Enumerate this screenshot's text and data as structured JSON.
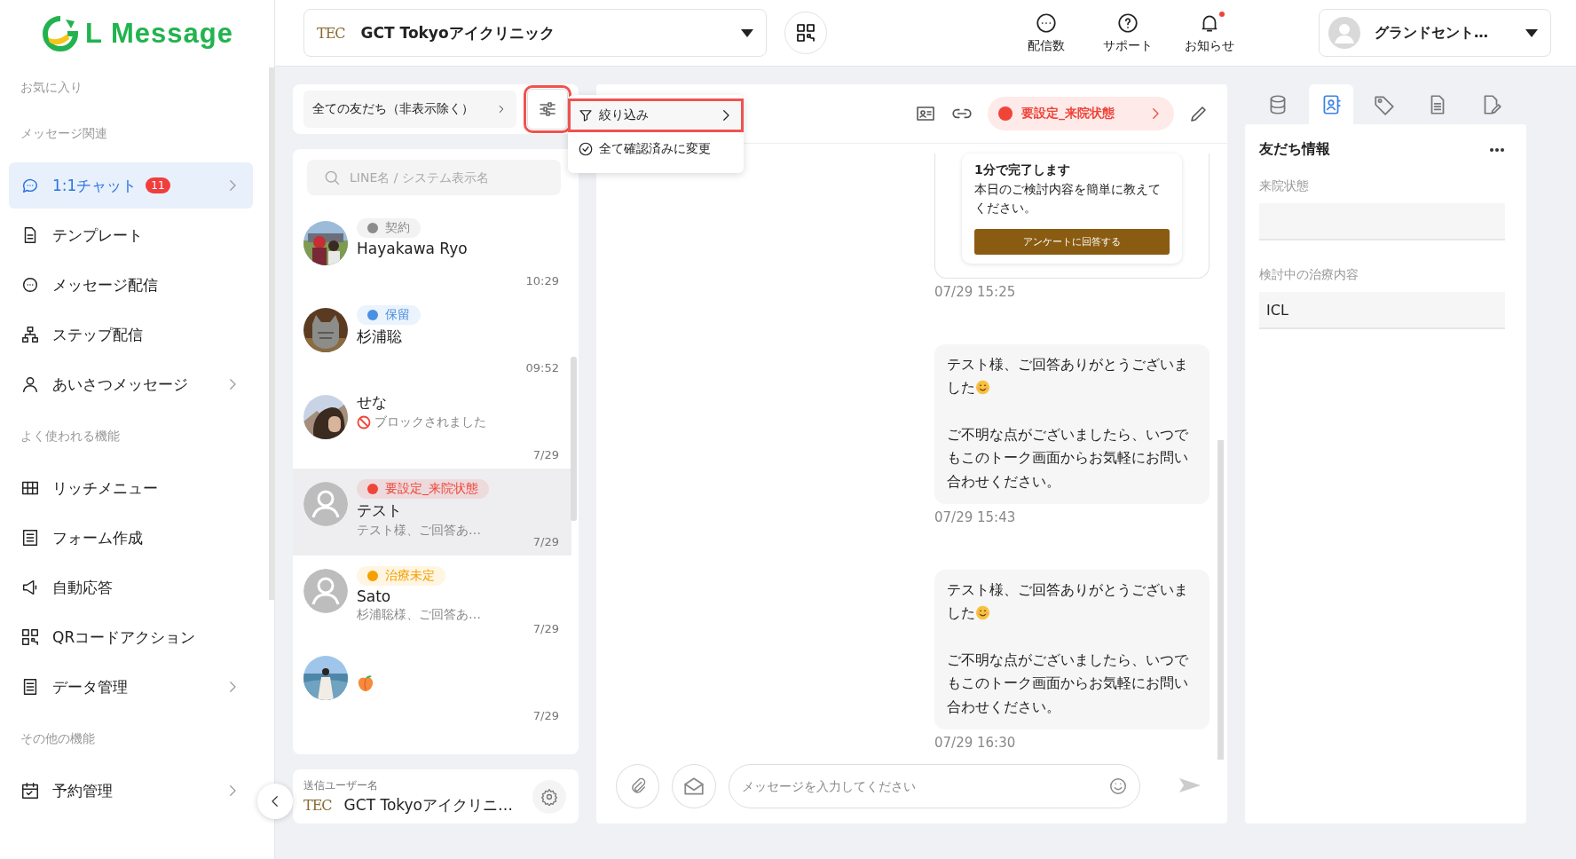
{
  "sidebar": {
    "logo": "L Message",
    "items": [
      {
        "kind": "heading",
        "label": "お気に入り"
      },
      {
        "kind": "heading",
        "label": "メッセージ関連"
      },
      {
        "kind": "item",
        "label": "1:1チャット",
        "selected": true,
        "badge": "11",
        "has_submenu": true
      },
      {
        "kind": "item",
        "label": "テンプレート",
        "selected": false,
        "has_submenu": false
      },
      {
        "kind": "item",
        "label": "メッセージ配信",
        "selected": false,
        "has_submenu": false
      },
      {
        "kind": "item",
        "label": "ステップ配信",
        "selected": false,
        "has_submenu": false
      },
      {
        "kind": "item",
        "label": "あいさつメッセージ",
        "selected": false,
        "has_submenu": true
      },
      {
        "kind": "heading",
        "label": "よく使われる機能"
      },
      {
        "kind": "item",
        "label": "リッチメニュー",
        "selected": false,
        "has_submenu": false
      },
      {
        "kind": "item",
        "label": "フォーム作成",
        "selected": false,
        "has_submenu": false
      },
      {
        "kind": "item",
        "label": "自動応答",
        "selected": false,
        "has_submenu": false
      },
      {
        "kind": "item",
        "label": "QRコードアクション",
        "selected": false,
        "has_submenu": false
      },
      {
        "kind": "item",
        "label": "データ管理",
        "selected": false,
        "has_submenu": true
      },
      {
        "kind": "heading",
        "label": "その他の機能"
      },
      {
        "kind": "item",
        "label": "予約管理",
        "selected": false,
        "has_submenu": true
      }
    ]
  },
  "topbar": {
    "account": {
      "logo": "TEC",
      "name": "GCT Tokyoアイクリニック"
    },
    "actions": [
      {
        "label": "配信数",
        "unread": false
      },
      {
        "label": "サポート",
        "unread": false
      },
      {
        "label": "お知らせ",
        "unread": true
      }
    ],
    "user": {
      "name": "グランドセント…"
    }
  },
  "chat_list": {
    "filter_label": "全ての友だち（非表示除く）",
    "filter_button_highlighted": true,
    "menu": [
      {
        "label": "絞り込み",
        "highlighted": true,
        "has_submenu": true
      },
      {
        "label": "全て確認済みに変更",
        "highlighted": false,
        "has_submenu": false
      }
    ],
    "search_placeholder": "LINE名 / システム表示名",
    "chats": [
      {
        "kind": "text",
        "has_photo": true,
        "tag": {
          "label": "契約",
          "color": "#8c8c8c"
        },
        "name": "Hayakawa Ryo",
        "time": "10:29",
        "selected": false,
        "blocked": false
      },
      {
        "kind": "text",
        "has_photo": true,
        "tag": {
          "label": "保留",
          "color": "#4a90e2"
        },
        "name": "杉浦聡",
        "time": "09:52",
        "selected": false,
        "blocked": false
      },
      {
        "kind": "text",
        "has_photo": true,
        "name": "せな",
        "preview": "ブロックされました",
        "time": "7/29",
        "selected": false,
        "blocked": true
      },
      {
        "kind": "text",
        "has_photo": false,
        "tag": {
          "label": "要設定_来院状態",
          "color": "#f04438"
        },
        "name": "テスト",
        "preview": "テスト様、ご回答あ…",
        "time": "7/29",
        "selected": true,
        "blocked": false
      },
      {
        "kind": "text",
        "has_photo": false,
        "tag": {
          "label": "治療未定",
          "color": "#f5a000"
        },
        "name": "Sato",
        "preview": "杉浦聡様、ご回答あ…",
        "time": "7/29",
        "selected": false,
        "blocked": false
      },
      {
        "kind": "emoji",
        "has_photo": true,
        "time": "7/29",
        "selected": false,
        "blocked": false
      }
    ],
    "sender": {
      "label": "送信ユーザー名",
      "logo": "TEC",
      "name": "GCT Tokyoアイクリニ…"
    }
  },
  "chat": {
    "status_tag": {
      "label": "要設定_来院状態",
      "color": "#f04438"
    },
    "survey": {
      "title": "1分で完了します",
      "text": "本日のご検討内容を簡単に教えてください。",
      "button": "アンケートに回答する",
      "time": "07/29 15:25"
    },
    "messages": [
      {
        "paragraphs": [
          "テスト様、ご回答ありがとうございました",
          "ご不明な点がございましたら、いつでもこのトーク画面からお気軽にお問い合わせください。"
        ],
        "smile": true,
        "time": "07/29 15:43"
      },
      {
        "paragraphs": [
          "テスト様、ご回答ありがとうございました",
          "ご不明な点がございましたら、いつでもこのトーク画面からお気軽にお問い合わせください。"
        ],
        "smile": true,
        "time": "07/29 16:30"
      }
    ],
    "input_placeholder": "メッセージを入力してください"
  },
  "info_panel": {
    "tabs": [
      {
        "selected": false
      },
      {
        "selected": true
      },
      {
        "selected": false
      },
      {
        "selected": false
      },
      {
        "selected": false
      }
    ],
    "title": "友だち情報",
    "fields": [
      {
        "label": "来院状態"
      },
      {
        "label": "検討中の治療内容",
        "value": "ICL"
      }
    ]
  }
}
